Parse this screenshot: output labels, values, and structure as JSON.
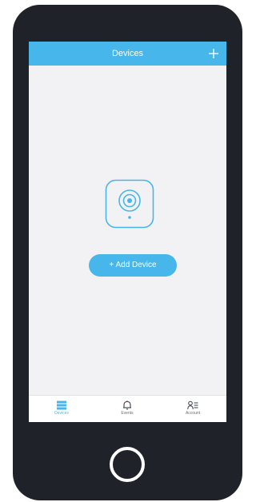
{
  "header": {
    "title": "Devices"
  },
  "main": {
    "add_device_label": "+ Add Device"
  },
  "tabbar": {
    "items": [
      {
        "label": "Devices",
        "icon": "devices-icon",
        "active": true
      },
      {
        "label": "Events",
        "icon": "bell-icon",
        "active": false
      },
      {
        "label": "Account",
        "icon": "account-icon",
        "active": false
      }
    ]
  },
  "colors": {
    "accent": "#47b6ea",
    "phone_frame": "#1f2228",
    "screen_background": "#f2f2f4"
  }
}
